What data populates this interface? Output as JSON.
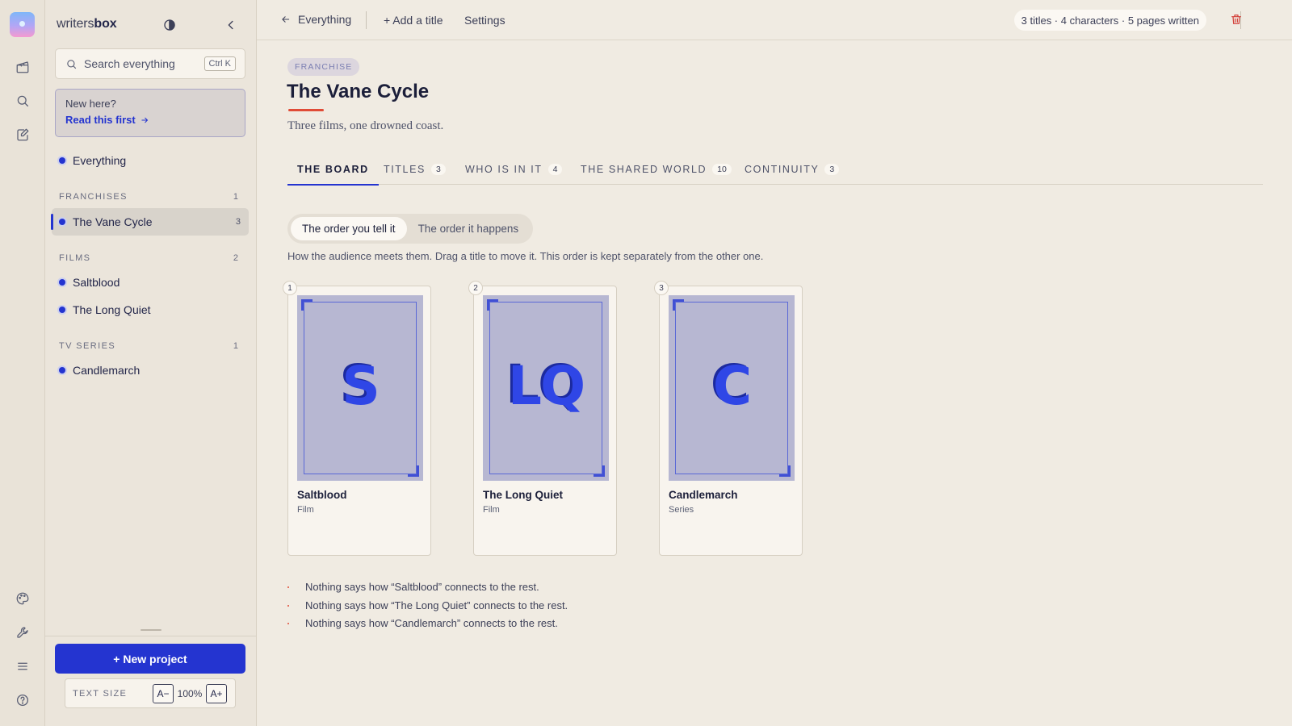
{
  "brand": {
    "light": "writers",
    "bold": "box"
  },
  "search": {
    "placeholder": "Search everything",
    "shortcut": "Ctrl K"
  },
  "new_here": {
    "question": "New here?",
    "link": "Read this first"
  },
  "sidebar": {
    "everything": "Everything",
    "sections": [
      {
        "label": "FRANCHISES",
        "count": "1",
        "items": [
          {
            "label": "The Vane Cycle",
            "count": "3",
            "active": true
          }
        ]
      },
      {
        "label": "FILMS",
        "count": "2",
        "items": [
          {
            "label": "Saltblood"
          },
          {
            "label": "The Long Quiet"
          }
        ]
      },
      {
        "label": "TV SERIES",
        "count": "1",
        "items": [
          {
            "label": "Candlemarch"
          }
        ]
      }
    ],
    "new_project": "+ New project",
    "text_size": {
      "label": "TEXT SIZE",
      "decrease": "A−",
      "value": "100%",
      "increase": "A+"
    }
  },
  "rail_icons": [
    "app-logo",
    "clapperboard-icon",
    "search-icon",
    "edit-document-icon",
    "palette-icon",
    "wrench-icon",
    "menu-icon",
    "help-icon"
  ],
  "topbar": {
    "back": "Everything",
    "add_title": "+ Add a title",
    "settings": "Settings",
    "stats": "3 titles · 4 characters · 5 pages written"
  },
  "project": {
    "badge": "FRANCHISE",
    "title": "The Vane Cycle",
    "subtitle": "Three films, one drowned coast."
  },
  "tabs": [
    {
      "label": "THE BOARD",
      "count": null,
      "active": true
    },
    {
      "label": "TITLES",
      "count": "3"
    },
    {
      "label": "WHO IS IN IT",
      "count": "4"
    },
    {
      "label": "THE SHARED WORLD",
      "count": "10"
    },
    {
      "label": "CONTINUITY",
      "count": "3"
    }
  ],
  "order_toggle": {
    "selected": "The order you tell it",
    "other": "The order it happens"
  },
  "helper": "How the audience meets them. Drag a title to move it. This order is kept separately from the other one.",
  "cards": [
    {
      "num": "1",
      "initials": "S",
      "name": "Saltblood",
      "type": "Film"
    },
    {
      "num": "2",
      "initials": "LQ",
      "name": "The Long Quiet",
      "type": "Film"
    },
    {
      "num": "3",
      "initials": "C",
      "name": "Candlemarch",
      "type": "Series"
    }
  ],
  "warnings": [
    "Nothing says how “Saltblood” connects to the rest.",
    "Nothing says how “The Long Quiet” connects to the rest.",
    "Nothing says how “Candlemarch” connects to the rest."
  ],
  "colors": {
    "accent": "#2434d0",
    "danger": "#d23b34",
    "underline": "#e04b36",
    "background": "#f0ebe2"
  }
}
